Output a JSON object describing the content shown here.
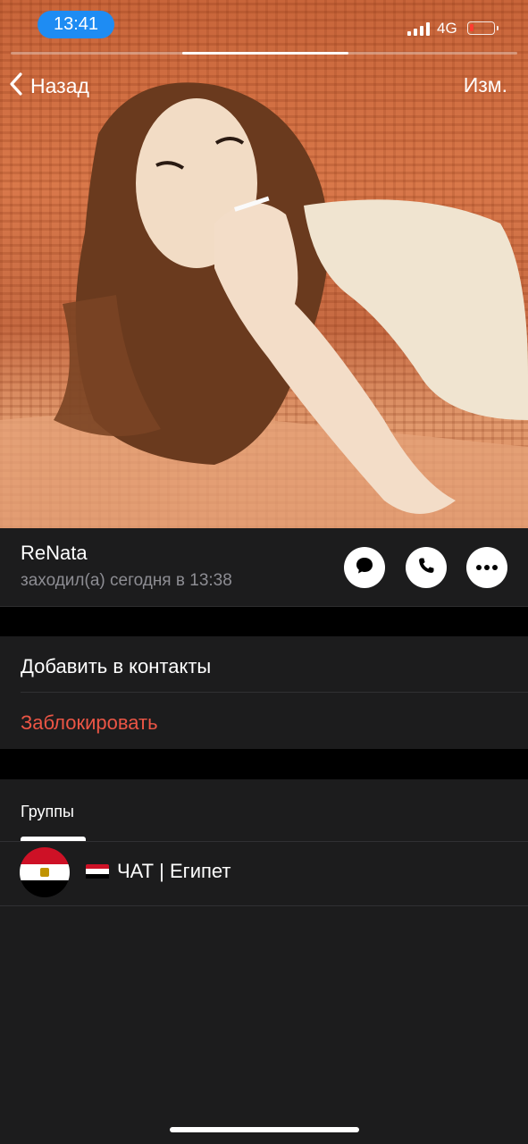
{
  "status_bar": {
    "time": "13:41",
    "network": "4G",
    "battery_level": 0.15
  },
  "nav": {
    "back_label": "Назад",
    "edit_label": "Изм."
  },
  "profile": {
    "name": "ReNata",
    "last_seen": "заходил(а) сегодня в 13:38",
    "photo_progress": {
      "current": 2,
      "total": 3
    },
    "actions": [
      {
        "icon": "message-icon",
        "label": "message"
      },
      {
        "icon": "phone-icon",
        "label": "call"
      },
      {
        "icon": "more-icon",
        "label": "more"
      }
    ]
  },
  "contact_actions": {
    "add_to_contacts": "Добавить в контакты",
    "block": "Заблокировать"
  },
  "groups": {
    "title": "Группы",
    "items": [
      {
        "flag_emoji": "🇪🇬",
        "name": "ЧАТ | Египет"
      }
    ]
  },
  "colors": {
    "accent": "#1e8cf3",
    "danger": "#eb5545",
    "background": "#1c1c1d",
    "separator_gap": "#000000",
    "secondary_text": "#8d8d93"
  }
}
